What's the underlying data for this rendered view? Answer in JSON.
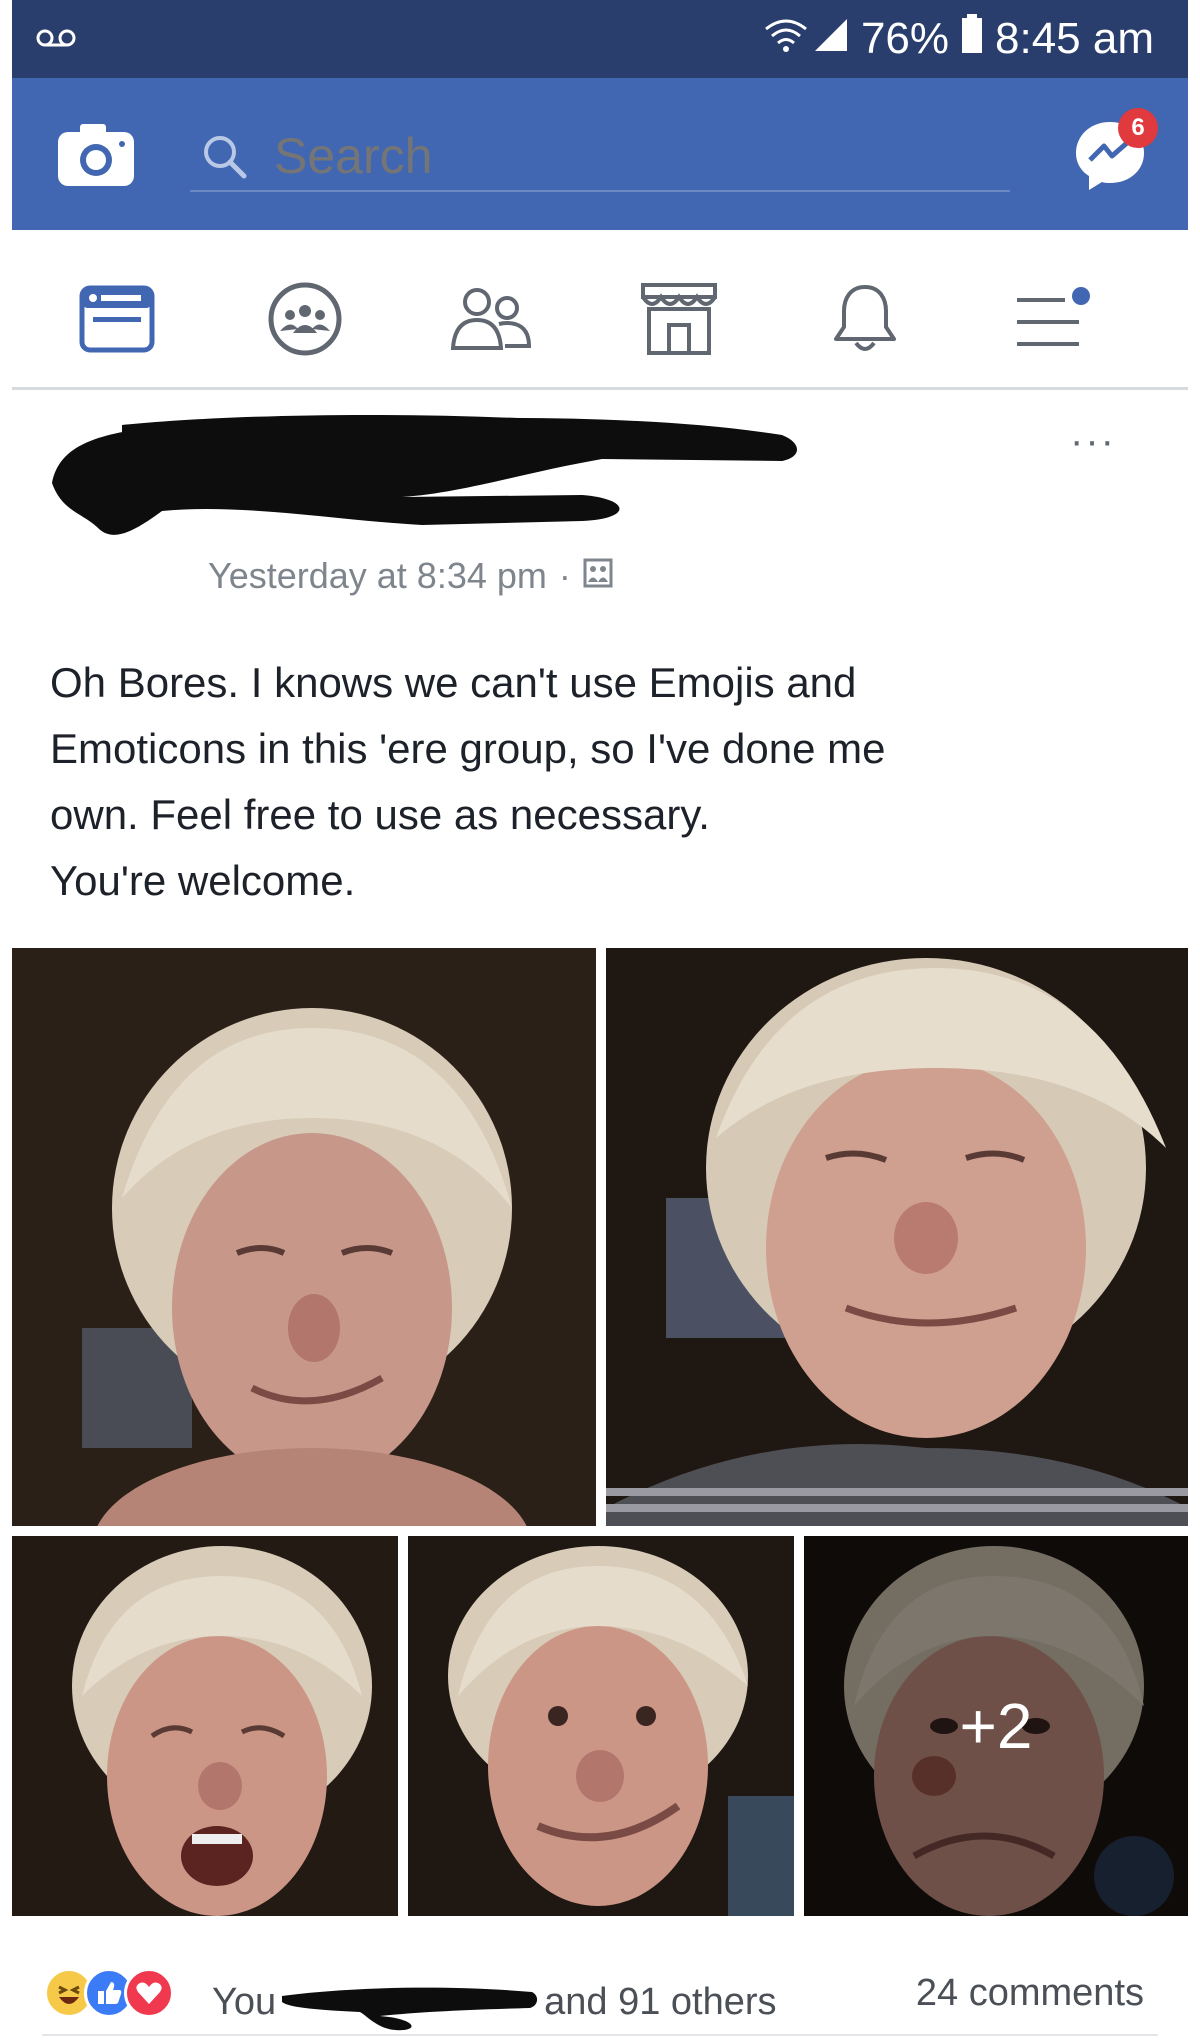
{
  "status_bar": {
    "battery": "76%",
    "time": "8:45 am"
  },
  "header": {
    "search_placeholder": "Search",
    "messenger_badge": "6"
  },
  "nav": {
    "tabs": [
      {
        "icon": "news-feed-icon",
        "active": true
      },
      {
        "icon": "groups-icon",
        "active": false
      },
      {
        "icon": "friends-icon",
        "active": false
      },
      {
        "icon": "marketplace-icon",
        "active": false
      },
      {
        "icon": "notifications-icon",
        "active": false
      },
      {
        "icon": "menu-icon",
        "active": false
      }
    ]
  },
  "post": {
    "timestamp": "Yesterday at 8:34 pm",
    "body_lines": [
      "Oh Bores. I knows we can't use Emojis and",
      "Emoticons in this 'ere group, so I've done me",
      "own. Feel free to use as necessary.",
      "You're welcome."
    ],
    "more_photos": "+2",
    "reactions": [
      "haha",
      "like",
      "love"
    ],
    "likers_prefix": "You",
    "likers_suffix": "and 91 others",
    "comments": "24 comments"
  },
  "colors": {
    "status_bar": "#2a3e6e",
    "header": "#4267b2",
    "active_tab": "#4267b2",
    "inactive_icon": "#606770"
  }
}
